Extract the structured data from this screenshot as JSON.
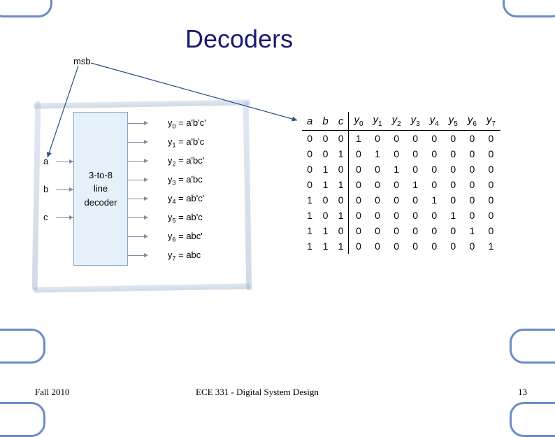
{
  "title": "Decoders",
  "msb_label": "msb",
  "inputs": [
    "a",
    "b",
    "c"
  ],
  "decoder_text": [
    "3-to-8",
    "line",
    "decoder"
  ],
  "outputs": [
    {
      "idx": "0",
      "expr": "a'b'c'"
    },
    {
      "idx": "1",
      "expr": "a'b'c"
    },
    {
      "idx": "2",
      "expr": "a'bc'"
    },
    {
      "idx": "3",
      "expr": "a'bc"
    },
    {
      "idx": "4",
      "expr": "ab'c'"
    },
    {
      "idx": "5",
      "expr": "ab'c"
    },
    {
      "idx": "6",
      "expr": "abc'"
    },
    {
      "idx": "7",
      "expr": "abc"
    }
  ],
  "truth_header_inputs": [
    "a",
    "b",
    "c"
  ],
  "truth_header_outputs": [
    "0",
    "1",
    "2",
    "3",
    "4",
    "5",
    "6",
    "7"
  ],
  "truth_rows": [
    {
      "in": [
        "0",
        "0",
        "0"
      ],
      "out": [
        "1",
        "0",
        "0",
        "0",
        "0",
        "0",
        "0",
        "0"
      ]
    },
    {
      "in": [
        "0",
        "0",
        "1"
      ],
      "out": [
        "0",
        "1",
        "0",
        "0",
        "0",
        "0",
        "0",
        "0"
      ]
    },
    {
      "in": [
        "0",
        "1",
        "0"
      ],
      "out": [
        "0",
        "0",
        "1",
        "0",
        "0",
        "0",
        "0",
        "0"
      ]
    },
    {
      "in": [
        "0",
        "1",
        "1"
      ],
      "out": [
        "0",
        "0",
        "0",
        "1",
        "0",
        "0",
        "0",
        "0"
      ]
    },
    {
      "in": [
        "1",
        "0",
        "0"
      ],
      "out": [
        "0",
        "0",
        "0",
        "0",
        "1",
        "0",
        "0",
        "0"
      ]
    },
    {
      "in": [
        "1",
        "0",
        "1"
      ],
      "out": [
        "0",
        "0",
        "0",
        "0",
        "0",
        "1",
        "0",
        "0"
      ]
    },
    {
      "in": [
        "1",
        "1",
        "0"
      ],
      "out": [
        "0",
        "0",
        "0",
        "0",
        "0",
        "0",
        "1",
        "0"
      ]
    },
    {
      "in": [
        "1",
        "1",
        "1"
      ],
      "out": [
        "0",
        "0",
        "0",
        "0",
        "0",
        "0",
        "0",
        "1"
      ]
    }
  ],
  "footer_left": "Fall 2010",
  "footer_center": "ECE 331 - Digital System Design",
  "footer_right": "13",
  "chart_data": {
    "type": "table",
    "title": "3-to-8 line decoder truth table",
    "inputs": [
      "a",
      "b",
      "c"
    ],
    "outputs": [
      "y0",
      "y1",
      "y2",
      "y3",
      "y4",
      "y5",
      "y6",
      "y7"
    ],
    "rows": [
      [
        0,
        0,
        0,
        1,
        0,
        0,
        0,
        0,
        0,
        0,
        0
      ],
      [
        0,
        0,
        1,
        0,
        1,
        0,
        0,
        0,
        0,
        0,
        0
      ],
      [
        0,
        1,
        0,
        0,
        0,
        1,
        0,
        0,
        0,
        0,
        0
      ],
      [
        0,
        1,
        1,
        0,
        0,
        0,
        1,
        0,
        0,
        0,
        0
      ],
      [
        1,
        0,
        0,
        0,
        0,
        0,
        0,
        1,
        0,
        0,
        0
      ],
      [
        1,
        0,
        1,
        0,
        0,
        0,
        0,
        0,
        1,
        0,
        0
      ],
      [
        1,
        1,
        0,
        0,
        0,
        0,
        0,
        0,
        0,
        1,
        0
      ],
      [
        1,
        1,
        1,
        0,
        0,
        0,
        0,
        0,
        0,
        0,
        1
      ]
    ]
  }
}
